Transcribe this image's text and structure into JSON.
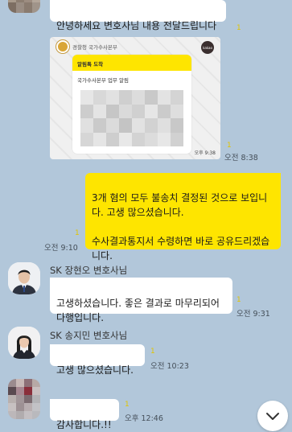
{
  "messages": {
    "m1": {
      "text": "안녕하세요 변호사님 내용 전달드립니다",
      "unread": "1"
    },
    "card": {
      "org": "경찰청 국가수사본부",
      "badge": "kakao",
      "alert_title": "알림톡 도착",
      "subject": "국가수사본부 업무 알림",
      "time": "오후 9:38",
      "outer_time": "오전 8:38",
      "unread": "1"
    },
    "m2": {
      "text": "3개 혐의 모두 불송치 결정된 것으로 보입니다. 고생 많으셨습니다.\n\n수사결과통지서 수령하면 바로 공유드리겠습니다.",
      "time": "오전 9:10",
      "unread": "1"
    },
    "lawyer1": {
      "name": "SK 장현오 변호사님",
      "text": "고생하셨습니다. 좋은 결과로 마무리되어 다행입니다.",
      "time": "오전 9:31",
      "unread": "1"
    },
    "lawyer2": {
      "name": "SK 송지민 변호사님",
      "text": "고생 많으셨습니다.",
      "time": "오전 10:23",
      "unread": "1"
    },
    "m5": {
      "text": "감사합니다.!!",
      "time": "오후 12:46",
      "unread": "1"
    }
  },
  "icons": {
    "scroll": "chevron-down-icon"
  },
  "colors": {
    "background": "#b2c7da",
    "my_bubble": "#fee500",
    "other_bubble": "#ffffff"
  }
}
